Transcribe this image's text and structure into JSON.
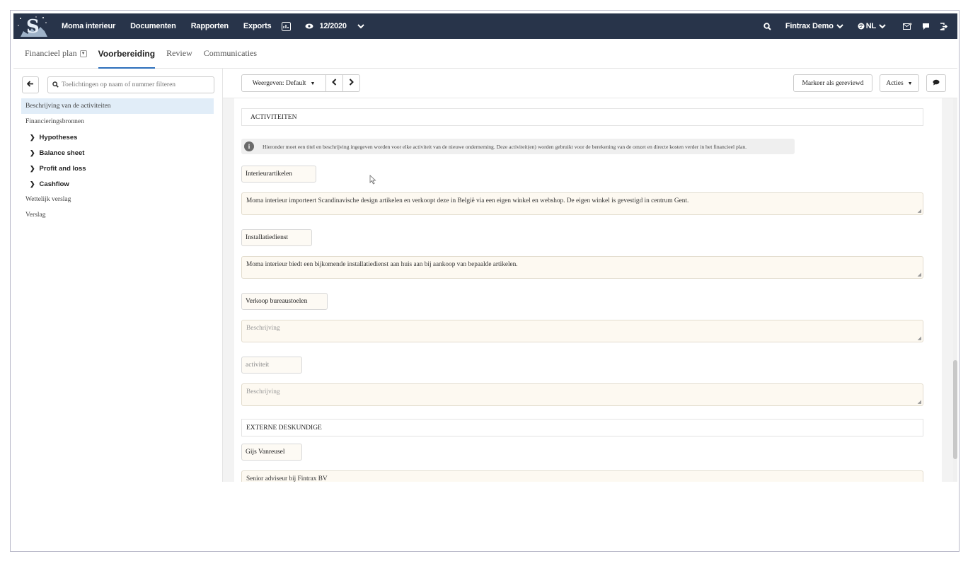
{
  "navbar": {
    "brand_icon": "s-logo-icon",
    "items": [
      "Moma interieur",
      "Documenten",
      "Rapporten",
      "Exports"
    ],
    "period": "12/2020",
    "user": "Fintrax Demo",
    "language": "NL",
    "icons": [
      "chart-icon",
      "eye-icon",
      "chevron-down-icon",
      "search-icon",
      "mail-icon",
      "comment-icon",
      "logout-icon"
    ]
  },
  "subtabs": {
    "plan": "Financieel plan",
    "voorbereiding": "Voorbereiding",
    "review": "Review",
    "communicaties": "Communicaties"
  },
  "left": {
    "filter_placeholder": "Toelichtingen op naam of nummer filteren",
    "tree": [
      {
        "label": "Beschrijving van de activiteiten"
      },
      {
        "label": "Financieringsbronnen"
      },
      {
        "label": "Hypotheses"
      },
      {
        "label": "Balance sheet"
      },
      {
        "label": "Profit and loss"
      },
      {
        "label": "Cashflow"
      },
      {
        "label": "Wettelijk verslag"
      },
      {
        "label": "Verslag"
      }
    ]
  },
  "toolbar": {
    "view": "Weergeven: Default",
    "review_button": "Markeer als gereviewd",
    "actions": "Acties"
  },
  "content": {
    "section_activities": "ACTIVITEITEN",
    "info": "Hieronder moet een titel en beschrijving ingegeven worden voor elke activiteit van de nieuwe onderneming. Deze activiteit(en) worden gebruikt voor de berekening van de omzet en directe kosten verder in het financieel plan.",
    "activities": [
      {
        "title": "Interieurartikelen",
        "description": "Moma interieur importeert Scandinavische design artikelen en verkoopt deze in België via een eigen winkel en webshop. De eigen winkel is gevestigd in centrum Gent."
      },
      {
        "title": "Installatiedienst",
        "description": "Moma interieur biedt een bijkomende installatiedienst aan huis aan bij aankoop van bepaalde artikelen."
      },
      {
        "title": "Verkoop bureaustoelen",
        "description": ""
      },
      {
        "title": "",
        "description": ""
      }
    ],
    "title_placeholder": "activiteit",
    "description_placeholder": "Beschrijving",
    "section_experts": "EXTERNE DESKUNDIGE",
    "expert_name": "Gijs Vanreusel",
    "expert_description": "Senior adviseur bij Fintrax BV"
  },
  "colors": {
    "navbar_bg": "#28344a",
    "accent": "#2c6fbb",
    "selected_bg": "#e1edf8",
    "input_bg": "#fdf9f1"
  }
}
